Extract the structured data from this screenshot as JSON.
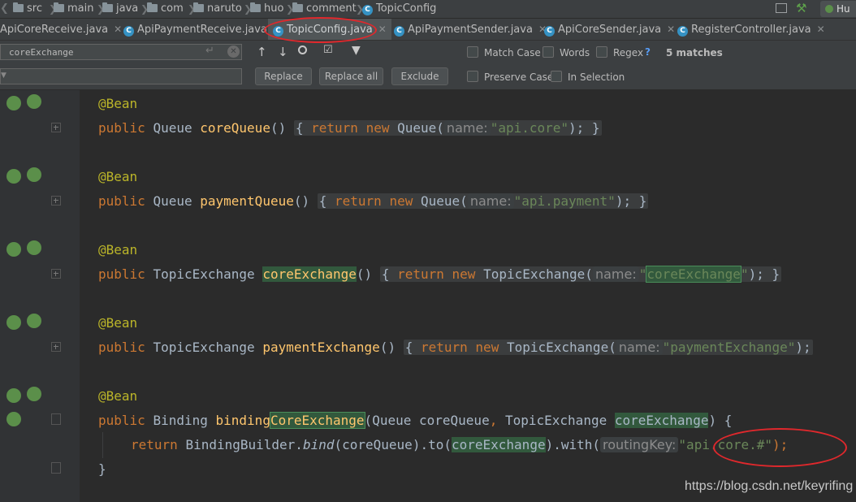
{
  "breadcrumb": {
    "items": [
      "src",
      "main",
      "java",
      "com",
      "naruto",
      "huo",
      "comment"
    ],
    "file": "TopicConfig",
    "right_label": "Hu"
  },
  "tabs": [
    {
      "label": "ApiCoreReceive.java",
      "active": false
    },
    {
      "label": "ApiPaymentReceive.java",
      "active": false
    },
    {
      "label": "TopicConfig.java",
      "active": true
    },
    {
      "label": "ApiPaymentSender.java",
      "active": false
    },
    {
      "label": "ApiCoreSender.java",
      "active": false
    },
    {
      "label": "RegisterController.java",
      "active": false
    }
  ],
  "find": {
    "search_value": "coreExchange",
    "replace_value": "",
    "buttons": {
      "replace": "Replace",
      "replace_all": "Replace all",
      "exclude": "Exclude"
    },
    "options": {
      "match_case": "Match Case",
      "words": "Words",
      "regex": "Regex",
      "regex_help": "?",
      "preserve_case": "Preserve Case",
      "in_selection": "In Selection"
    },
    "matches": "5 matches"
  },
  "code": {
    "annotation": "@Bean",
    "kw_public": "public",
    "kw_return": "return",
    "kw_new": "new",
    "types": {
      "queue": "Queue",
      "topic_exchange": "TopicExchange",
      "binding": "Binding",
      "binding_builder": "BindingBuilder"
    },
    "methods": {
      "core_queue": "coreQueue",
      "payment_queue": "paymentQueue",
      "core_exchange": "coreExchange",
      "payment_exchange": "paymentExchange",
      "binding_prefix": "binding",
      "binding_suffix": "CoreExchange",
      "bind": "bind",
      "to": "to",
      "with": "with"
    },
    "params": {
      "core_queue": "coreQueue",
      "core_exchange": "coreExchange"
    },
    "hints": {
      "name": "name:",
      "routing_key": "routingKey:"
    },
    "strings": {
      "api_core": "\"api.core\"",
      "api_payment": "\"api.payment\"",
      "core_exchange_q1": "\"",
      "core_exchange_val": "coreExchange",
      "core_exchange_q2": "\"",
      "payment_exchange": "\"paymentExchange\"",
      "routing": "\"api.core.#\""
    }
  },
  "watermark": "https://blog.csdn.net/keyrifing",
  "colors": {
    "annotation": "#bbb529",
    "keyword": "#cc7832",
    "method": "#ffc66d",
    "string": "#6a8759",
    "highlight": "#32593d",
    "circle": "#e0282c"
  }
}
